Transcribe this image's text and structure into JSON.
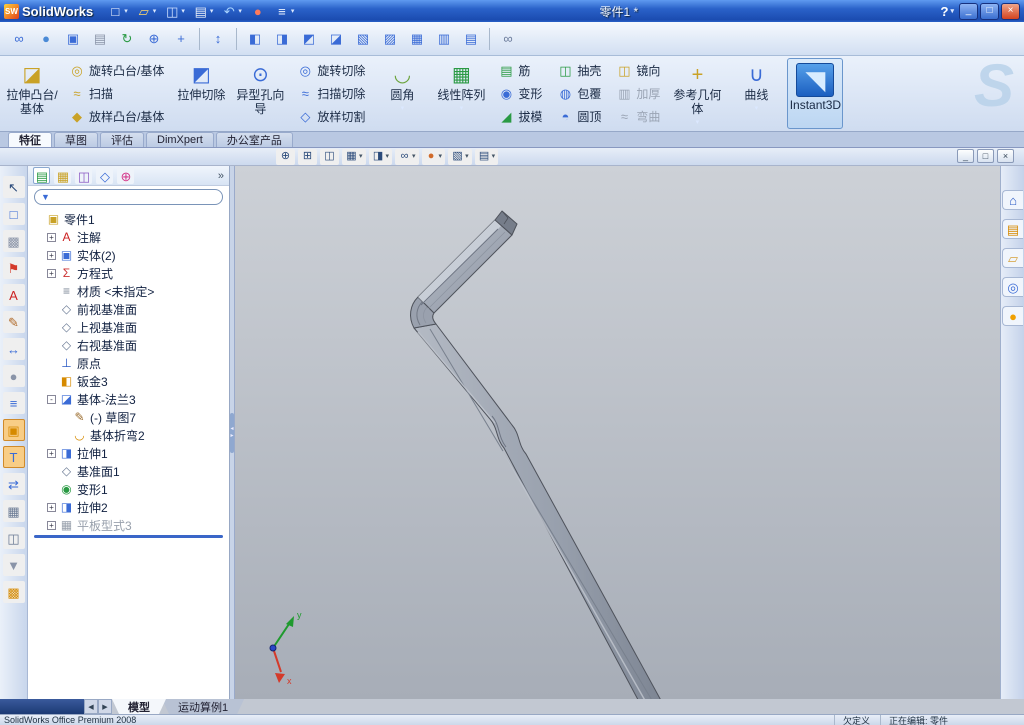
{
  "colors": {
    "titlebar_blue": "#2a62c9",
    "ribbon_bg": "#dfe8f6",
    "viewport_top": "#cdd1d7",
    "viewport_bottom": "#a7adb7",
    "model_gray": "#9aa1ae",
    "rollback_blue": "#3a66c8",
    "triad_x_red": "#d43a2a",
    "triad_y_green": "#1f9a2e",
    "origin_blue": "#2a46c8"
  },
  "titlebar": {
    "app_name": "SolidWorks",
    "logo_badge": "SW",
    "document_title": "零件1 *",
    "help_label": "?",
    "quick_icons": [
      {
        "name": "new-document-icon",
        "dropdown": true
      },
      {
        "name": "open-icon",
        "dropdown": true
      },
      {
        "name": "save-icon",
        "dropdown": true
      },
      {
        "name": "print-icon",
        "dropdown": true
      },
      {
        "name": "undo-icon",
        "dropdown": true
      },
      {
        "name": "rebuild-icon",
        "dropdown": false
      },
      {
        "name": "options-icon",
        "dropdown": true
      }
    ],
    "window_controls": [
      {
        "name": "minimize-button",
        "glyph": "_"
      },
      {
        "name": "restore-button",
        "glyph": "□"
      },
      {
        "name": "close-button",
        "glyph": "×"
      }
    ]
  },
  "std_toolbar": {
    "icons": [
      "mate-icon",
      "sphere-icon",
      "viewport-icon",
      "library-icon",
      "rebuild-refresh-icon",
      "zoom-globe-icon",
      "move-cross-icon",
      "|",
      "updown-arrow-icon",
      "|",
      "front-view-icon",
      "back-view-icon",
      "left-view-icon",
      "right-view-icon",
      "top-view-icon",
      "bottom-view-icon",
      "isometric-view-icon",
      "dimetric-view-icon",
      "trimetric-view-icon",
      "|",
      "link-icon"
    ]
  },
  "ribbon": {
    "tabs": [
      {
        "id": "features",
        "label": "特征",
        "active": true
      },
      {
        "id": "sketch",
        "label": "草图",
        "active": false
      },
      {
        "id": "evaluate",
        "label": "评估",
        "active": false
      },
      {
        "id": "dimxpert",
        "label": "DimXpert",
        "active": false
      },
      {
        "id": "office",
        "label": "办公室产品",
        "active": false
      }
    ],
    "columns": [
      {
        "type": "large",
        "name": "extrude-boss-button",
        "icon": "extrude-boss-icon",
        "label": "拉伸凸台/基体"
      },
      {
        "type": "stack",
        "items": [
          {
            "name": "revolve-boss-button",
            "icon": "revolve-boss-icon",
            "label": "旋转凸台/基体"
          },
          {
            "name": "sweep-button",
            "icon": "sweep-icon",
            "label": "扫描"
          },
          {
            "name": "loft-boss-button",
            "icon": "loft-boss-icon",
            "label": "放样凸台/基体"
          }
        ]
      },
      {
        "type": "large",
        "name": "extrude-cut-button",
        "icon": "extrude-cut-icon",
        "label": "拉伸切除"
      },
      {
        "type": "large",
        "name": "hole-wizard-button",
        "icon": "hole-wizard-icon",
        "label": "异型孔向导"
      },
      {
        "type": "stack",
        "items": [
          {
            "name": "revolve-cut-button",
            "icon": "revolve-cut-icon",
            "label": "旋转切除"
          },
          {
            "name": "swept-cut-button",
            "icon": "swept-cut-icon",
            "label": "扫描切除"
          },
          {
            "name": "lofted-cut-button",
            "icon": "lofted-cut-icon",
            "label": "放样切割"
          }
        ]
      },
      {
        "type": "large",
        "name": "fillet-button",
        "icon": "fillet-icon",
        "label": "圆角",
        "dropdown": true
      },
      {
        "type": "large",
        "name": "linear-pattern-button",
        "icon": "linear-pattern-icon",
        "label": "线性阵列",
        "dropdown": true
      },
      {
        "type": "stack",
        "items": [
          {
            "name": "rib-button",
            "icon": "rib-icon",
            "label": "筋"
          },
          {
            "name": "deform-button",
            "icon": "deform-icon",
            "label": "变形"
          },
          {
            "name": "draft-button",
            "icon": "draft-icon",
            "label": "拔模"
          }
        ]
      },
      {
        "type": "stack",
        "items": [
          {
            "name": "shell-button",
            "icon": "shell-icon",
            "label": "抽壳"
          },
          {
            "name": "wrap-button",
            "icon": "wrap-icon",
            "label": "包覆"
          },
          {
            "name": "dome-button",
            "icon": "dome-icon",
            "label": "圆顶"
          }
        ]
      },
      {
        "type": "stack",
        "items": [
          {
            "name": "mirror-button",
            "icon": "mirror-icon",
            "label": "镜向"
          },
          {
            "name": "thicken-button",
            "icon": "thicken-icon",
            "label": "加厚",
            "disabled": true
          },
          {
            "name": "flex-button",
            "icon": "flex-icon",
            "label": "弯曲",
            "disabled": true
          }
        ]
      },
      {
        "type": "large",
        "name": "reference-geometry-button",
        "icon": "reference-geometry-icon",
        "label": "参考几何体",
        "dropdown": true
      },
      {
        "type": "large",
        "name": "curves-button",
        "icon": "curves-icon",
        "label": "曲线",
        "dropdown": true
      },
      {
        "type": "large",
        "name": "instant3d-button",
        "icon": "instant3d-icon",
        "label": "Instant3D",
        "selected": true
      }
    ]
  },
  "viewbar": {
    "icons": [
      {
        "name": "zoom-fit-icon",
        "dropdown": false
      },
      {
        "name": "zoom-area-icon",
        "dropdown": false
      },
      {
        "name": "section-view-icon",
        "dropdown": false
      },
      {
        "name": "view-orientation-icon",
        "dropdown": true
      },
      {
        "name": "display-style-icon",
        "dropdown": true
      },
      {
        "name": "hide-show-icon",
        "dropdown": true
      },
      {
        "name": "appearance-icon",
        "dropdown": true
      },
      {
        "name": "scene-icon",
        "dropdown": true
      },
      {
        "name": "view-settings-icon",
        "dropdown": true
      }
    ],
    "doc_controls": [
      {
        "name": "doc-minimize-button",
        "glyph": "_"
      },
      {
        "name": "doc-restore-button",
        "glyph": "□"
      },
      {
        "name": "doc-close-button",
        "glyph": "×"
      }
    ]
  },
  "left_strip": {
    "icons": [
      {
        "name": "pointer-icon",
        "active": false
      },
      {
        "name": "wireframe-icon",
        "active": false
      },
      {
        "name": "shadow-icon",
        "active": false
      },
      {
        "name": "flag-icon",
        "active": false
      },
      {
        "name": "annotation-icon",
        "active": false
      },
      {
        "name": "pen-icon",
        "active": false
      },
      {
        "name": "measure-icon",
        "active": false
      },
      {
        "name": "sphere2-icon",
        "active": false
      },
      {
        "name": "layers-icon",
        "active": false
      },
      {
        "name": "box-highlight-icon",
        "active": true
      },
      {
        "name": "text-icon",
        "active": true
      },
      {
        "name": "swap-icon",
        "active": false
      },
      {
        "name": "grid-icon",
        "active": false
      },
      {
        "name": "section2-icon",
        "active": false
      },
      {
        "name": "stamp-icon",
        "active": false
      },
      {
        "name": "palette-icon",
        "active": false
      }
    ]
  },
  "tree_panel": {
    "header_icons": [
      "featuremanager-tab-icon",
      "propertymanager-tab-icon",
      "configurationmanager-tab-icon",
      "dimxpertmanager-tab-icon",
      "displaymanager-tab-icon"
    ],
    "chevron": "»",
    "filter_placeholder": "",
    "root": {
      "name": "tree-root-part",
      "icon": "part-icon",
      "label": "零件1"
    },
    "items": [
      {
        "label": "注解",
        "icon": "annotations-icon",
        "expand": "+",
        "indent": 1
      },
      {
        "label": "实体(2)",
        "icon": "solid-bodies-icon",
        "expand": "+",
        "indent": 1
      },
      {
        "label": "方程式",
        "icon": "equations-icon",
        "expand": "+",
        "indent": 1
      },
      {
        "label": "材质 <未指定>",
        "icon": "material-icon",
        "indent": 1
      },
      {
        "label": "前视基准面",
        "icon": "plane-icon",
        "indent": 1
      },
      {
        "label": "上视基准面",
        "icon": "plane-icon",
        "indent": 1
      },
      {
        "label": "右视基准面",
        "icon": "plane-icon",
        "indent": 1
      },
      {
        "label": "原点",
        "icon": "origin-icon",
        "indent": 1
      },
      {
        "label": "钣金3",
        "icon": "sheet-metal-icon",
        "indent": 1
      },
      {
        "label": "基体-法兰3",
        "icon": "base-flange-icon",
        "expand": "-",
        "indent": 1
      },
      {
        "label": "(-) 草图7",
        "icon": "sketch2-icon",
        "indent": 2
      },
      {
        "label": "基体折弯2",
        "icon": "bend-icon",
        "indent": 2
      },
      {
        "label": "拉伸1",
        "icon": "extrude1-icon",
        "expand": "+",
        "indent": 1
      },
      {
        "label": "基准面1",
        "icon": "plane-icon",
        "indent": 1
      },
      {
        "label": "变形1",
        "icon": "deform-feature-icon",
        "indent": 1
      },
      {
        "label": "拉伸2",
        "icon": "extrude1-icon",
        "expand": "+",
        "indent": 1
      },
      {
        "label": "平板型式3",
        "icon": "flat-pattern-icon",
        "expand": "+",
        "indent": 1,
        "disabled": true
      }
    ]
  },
  "task_pane": {
    "icons": [
      "home-icon",
      "design-library-icon",
      "file-explorer-icon",
      "search-tab-icon",
      "palette-ball-icon"
    ]
  },
  "bottom_bar": {
    "scroll_buttons": [
      {
        "name": "tab-scroll-left-button",
        "glyph": "◀"
      },
      {
        "name": "tab-scroll-right-button",
        "glyph": "▶"
      }
    ],
    "tabs": [
      {
        "id": "model",
        "label": "模型",
        "active": true
      },
      {
        "id": "motion-study-1",
        "label": "运动算例1",
        "active": false
      }
    ]
  },
  "statusbar": {
    "product": "SolidWorks Office Premium 2008",
    "state": "欠定义",
    "editing": "正在编辑: 零件"
  }
}
